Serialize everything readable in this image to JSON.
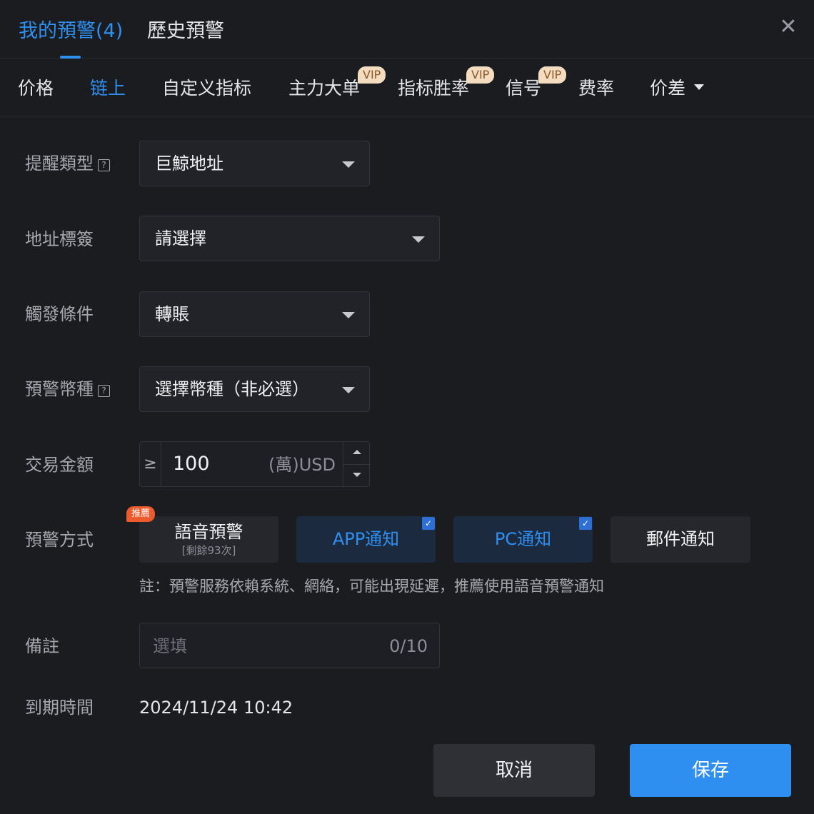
{
  "header": {
    "tabs": [
      {
        "label": "我的預警(4)",
        "active": true
      },
      {
        "label": "歷史預警",
        "active": false
      }
    ],
    "close_glyph": "✕"
  },
  "categories": [
    {
      "label": "价格",
      "active": false,
      "vip": false
    },
    {
      "label": "链上",
      "active": true,
      "vip": false
    },
    {
      "label": "自定义指标",
      "active": false,
      "vip": false
    },
    {
      "label": "主力大单",
      "active": false,
      "vip": true
    },
    {
      "label": "指标胜率",
      "active": false,
      "vip": true
    },
    {
      "label": "信号",
      "active": false,
      "vip": true
    },
    {
      "label": "费率",
      "active": false,
      "vip": false
    },
    {
      "label": "价差",
      "active": false,
      "vip": false,
      "dropdown": true
    }
  ],
  "vip_label": "VIP",
  "form": {
    "alert_type": {
      "label": "提醒類型",
      "help_glyph": "?",
      "value": "巨鯨地址"
    },
    "address_tag": {
      "label": "地址標簽",
      "value": "請選擇"
    },
    "trigger": {
      "label": "觸發條件",
      "value": "轉賬"
    },
    "coin": {
      "label": "預警幣種",
      "help_glyph": "?",
      "value": "選擇幣種（非必選）"
    },
    "amount": {
      "label": "交易金額",
      "operator": "≥",
      "value": "100",
      "unit": "(萬)USD"
    },
    "methods": {
      "label": "預警方式",
      "recommend_badge": "推薦",
      "options": [
        {
          "label": "語音預警",
          "sub": "[剩餘93次]",
          "selected": false
        },
        {
          "label": "APP通知",
          "selected": true
        },
        {
          "label": "PC通知",
          "selected": true
        },
        {
          "label": "郵件通知",
          "selected": false
        }
      ],
      "check_glyph": "✓",
      "note": "註：預警服務依賴系統、網絡，可能出現延遲，推薦使用語音預警通知"
    },
    "remark": {
      "label": "備註",
      "placeholder": "選填",
      "counter": "0/10"
    },
    "expiry": {
      "label": "到期時間",
      "value": "2024/11/24 10:42"
    }
  },
  "buttons": {
    "cancel": "取消",
    "save": "保存"
  },
  "colors": {
    "accent": "#2e8ff0",
    "background": "#1b1c20",
    "vip_badge": "#f3dcc0",
    "recommend_badge": "#ec5a2e"
  }
}
